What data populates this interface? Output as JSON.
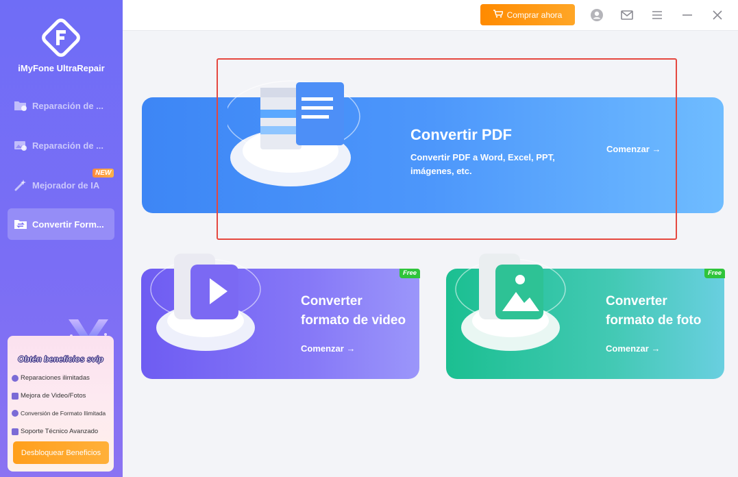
{
  "app": {
    "name": "iMyFone UltraRepair"
  },
  "sidebar": {
    "items": [
      {
        "label": "Reparación de ...",
        "icon": "folder-repair-icon"
      },
      {
        "label": "Reparación de ...",
        "icon": "photo-repair-icon"
      },
      {
        "label": "Mejorador de IA",
        "icon": "ai-wand-icon",
        "badge": "NEW"
      },
      {
        "label": "Convertir Form...",
        "icon": "convert-folder-icon",
        "active": true
      }
    ]
  },
  "promo": {
    "title": "Obtén beneficios svip",
    "benefits": [
      "Reparaciones ilimitadas",
      "Mejora de Video/Fotos",
      "Conversión de Formato Ilimitada",
      "Soporte Técnico Avanzado"
    ],
    "button": "Desbloquear Beneficios"
  },
  "topbar": {
    "buy": "Comprar ahora",
    "icons": [
      "account-icon",
      "mail-icon",
      "menu-icon",
      "minimize-icon",
      "close-icon"
    ]
  },
  "cards": {
    "pdf": {
      "title": "Convertir PDF",
      "desc1": "Convertir PDF a Word, Excel, PPT,",
      "desc2": "imágenes, etc.",
      "link": "Comenzar →"
    },
    "video": {
      "title1": "Converter",
      "title2": "formato de video",
      "link": "Comenzar →",
      "badge": "Free"
    },
    "photo": {
      "title1": "Converter",
      "title2": "formato de foto",
      "link": "Comenzar →",
      "badge": "Free"
    }
  },
  "colors": {
    "accent": "#6f6df6",
    "highlight": "#e5473e",
    "buy": "#ff8a00",
    "free": "#2fc43b"
  }
}
